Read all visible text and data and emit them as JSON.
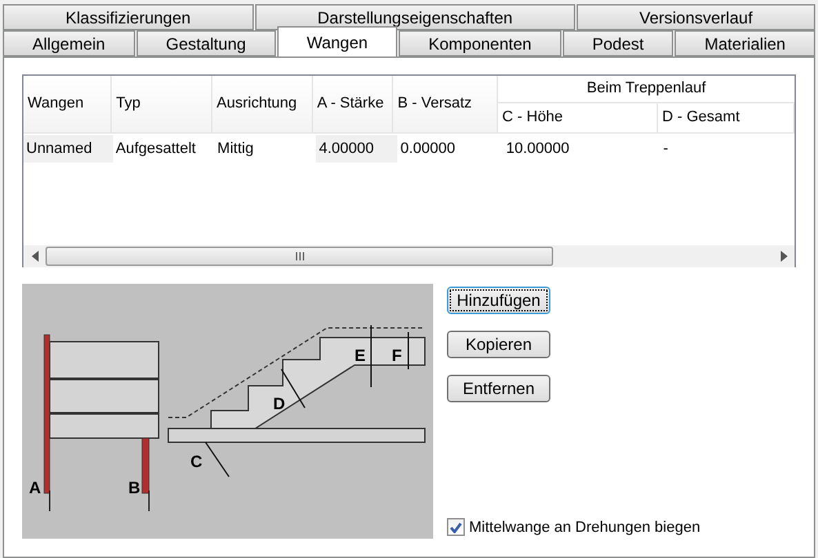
{
  "tabs_row_1": [
    {
      "label": "Klassifizierungen",
      "selected": false
    },
    {
      "label": "Darstellungseigenschaften",
      "selected": false
    },
    {
      "label": "Versionsverlauf",
      "selected": false
    }
  ],
  "tabs_row_2": [
    {
      "label": "Allgemein",
      "selected": false
    },
    {
      "label": "Gestaltung",
      "selected": false
    },
    {
      "label": "Wangen",
      "selected": true
    },
    {
      "label": "Komponenten",
      "selected": false
    },
    {
      "label": "Podest",
      "selected": false
    },
    {
      "label": "Materialien",
      "selected": false
    }
  ],
  "table": {
    "group_header": "Beim Treppenlauf",
    "columns": [
      "Wangen",
      "Typ",
      "Ausrichtung",
      "A - Stärke",
      "B - Versatz",
      "C - Höhe",
      "D - Gesamt"
    ],
    "rows": [
      {
        "cells": [
          {
            "text": "Unnamed",
            "shaded": true
          },
          {
            "text": "Aufgesattelt",
            "shaded": false
          },
          {
            "text": "Mittig",
            "shaded": false
          },
          {
            "text": "4.00000",
            "shaded": true
          },
          {
            "text": "0.00000",
            "shaded": false
          },
          {
            "text": "10.00000",
            "shaded": false
          },
          {
            "text": "-",
            "shaded": false
          }
        ]
      }
    ]
  },
  "diagram": {
    "labels": [
      "A",
      "B",
      "C",
      "D",
      "E",
      "F"
    ]
  },
  "buttons": [
    {
      "label": "Hinzufügen",
      "focused": true
    },
    {
      "label": "Kopieren",
      "focused": false
    },
    {
      "label": "Entfernen",
      "focused": false
    }
  ],
  "checkbox": {
    "label": "Mittelwange an Drehungen biegen",
    "checked": true
  }
}
